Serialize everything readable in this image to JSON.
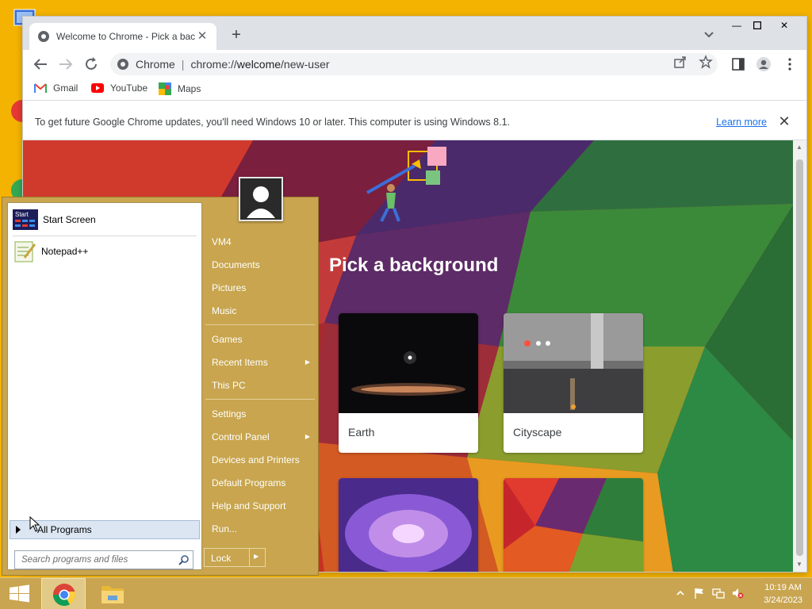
{
  "chrome": {
    "tab_title": "Welcome to Chrome - Pick a bac",
    "site_name": "Chrome",
    "url_prefix": "chrome://",
    "url_host": "welcome",
    "url_path": "/new-user",
    "bookmarks": [
      "Gmail",
      "YouTube",
      "Maps"
    ],
    "infobar_message": "To get future Google Chrome updates, you'll need Windows 10 or later. This computer is using Windows 8.1.",
    "infobar_link": "Learn more",
    "page_heading": "Pick a background",
    "backgrounds": [
      "Earth",
      "Cityscape"
    ]
  },
  "start_menu": {
    "pinned": [
      "Start Screen",
      "Notepad++"
    ],
    "start_tile_text": "Start",
    "all_programs": "All Programs",
    "search_placeholder": "Search programs and files",
    "right_items": {
      "user": "VM4",
      "documents": "Documents",
      "pictures": "Pictures",
      "music": "Music",
      "games": "Games",
      "recent_items": "Recent Items",
      "this_pc": "This PC",
      "settings": "Settings",
      "control_panel": "Control Panel",
      "devices_printers": "Devices and Printers",
      "default_programs": "Default Programs",
      "help_support": "Help and Support",
      "run": "Run..."
    },
    "lock": "Lock"
  },
  "taskbar": {
    "time": "10:19 AM",
    "date": "3/24/2023"
  },
  "colors": {
    "desktop": "#f5b301",
    "start_menu_bg": "#c8a54e",
    "chrome_link": "#1a73e8"
  }
}
